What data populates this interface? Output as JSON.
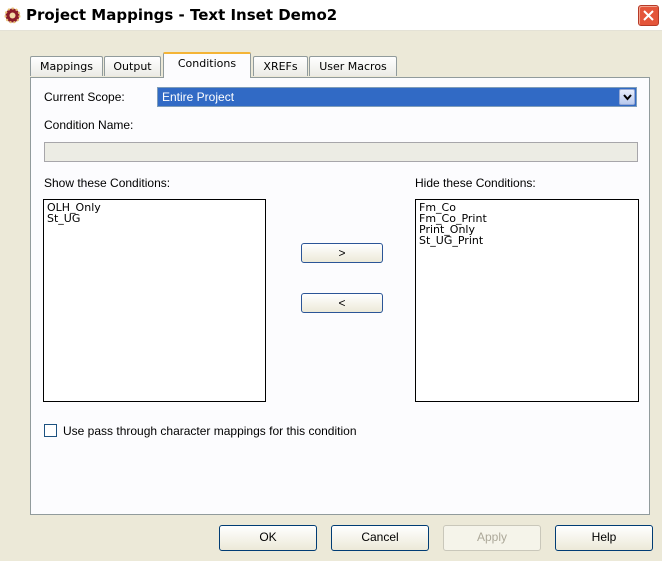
{
  "window": {
    "title": "Project Mappings - Text Inset Demo2",
    "icon": "gear-app-icon",
    "close_icon": "close-icon"
  },
  "tabs": [
    {
      "label": "Mappings",
      "active": false
    },
    {
      "label": "Output",
      "active": false
    },
    {
      "label": "Conditions",
      "active": true
    },
    {
      "label": "XREFs",
      "active": false
    },
    {
      "label": "User Macros",
      "active": false
    }
  ],
  "conditions": {
    "current_scope_label": "Current Scope:",
    "current_scope_value": "Entire Project",
    "condition_name_label": "Condition Name:",
    "condition_name_value": "",
    "show_label": "Show these Conditions:",
    "show_items": [
      "OLH_Only",
      "St_UG"
    ],
    "hide_label": "Hide these Conditions:",
    "hide_items": [
      "Fm_Co",
      "Fm_Co_Print",
      "Print_Only",
      "St_UG_Print"
    ],
    "move_right_label": ">",
    "move_left_label": "<",
    "passthrough_label": "Use pass through character mappings for this condition",
    "passthrough_checked": false
  },
  "buttons": {
    "ok": "OK",
    "cancel": "Cancel",
    "apply": "Apply",
    "help": "Help"
  },
  "colors": {
    "dialog_bg": "#ece9d8",
    "selection": "#316ac5",
    "close_button": "#e4553a"
  }
}
